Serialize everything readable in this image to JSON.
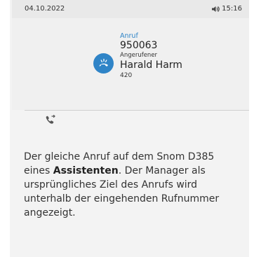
{
  "status": {
    "date": "04.10.2022",
    "time": "15:16",
    "volume_icon": "speaker-icon"
  },
  "call": {
    "label_call": "Anruf",
    "number": "950063",
    "label_called": "Angerufener",
    "called_name": "Harald Harm",
    "called_ext": "420",
    "icon": "incoming-call-icon",
    "accent": "#2f84c7"
  },
  "softkey": {
    "icon": "call-transfer-icon"
  },
  "caption": {
    "part1": "Der gleiche Anruf auf dem Snom D385 eines ",
    "bold": "Assistenten",
    "part2": ". Der Manager als ursprüngliches Ziel des Anrufs wird unterhalb der eingehenden Rufnummer angezeigt."
  }
}
